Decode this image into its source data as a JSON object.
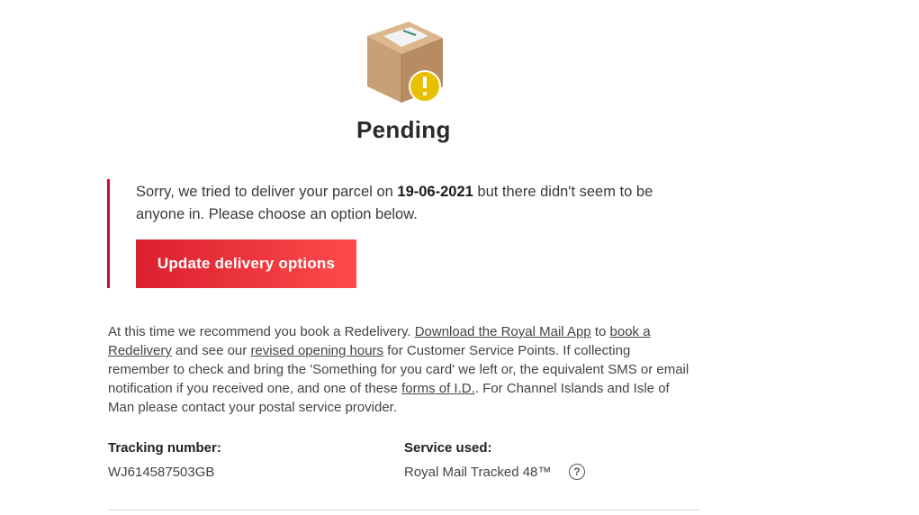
{
  "status": {
    "title": "Pending",
    "icon": "parcel-warning-icon"
  },
  "alert": {
    "text_before_date": "Sorry, we tried to deliver your parcel on ",
    "date": "19-06-2021",
    "text_after_date": " but there didn't seem to be anyone in. Please choose an option below.",
    "button_label": "Update delivery options",
    "accent_color": "#c8102e"
  },
  "info": {
    "part1": "At this time we recommend you book a Redelivery. ",
    "link_app": "Download the Royal Mail App",
    "part2": " to ",
    "link_redelivery": "book a Redelivery",
    "part3": " and see our ",
    "link_hours": "revised opening hours",
    "part4": " for Customer Service Points. If collecting remember to check and bring the 'Something for you card' we left or, the equivalent SMS or email notification if you received one, and one of these ",
    "link_id": "forms of I.D.",
    "part5": ". For Channel Islands and Isle of Man please contact your postal service provider."
  },
  "details": {
    "tracking_label": "Tracking number:",
    "tracking_value": "WJ614587503GB",
    "service_label": "Service used:",
    "service_value": "Royal Mail Tracked 48™",
    "help_icon": "question-icon"
  }
}
